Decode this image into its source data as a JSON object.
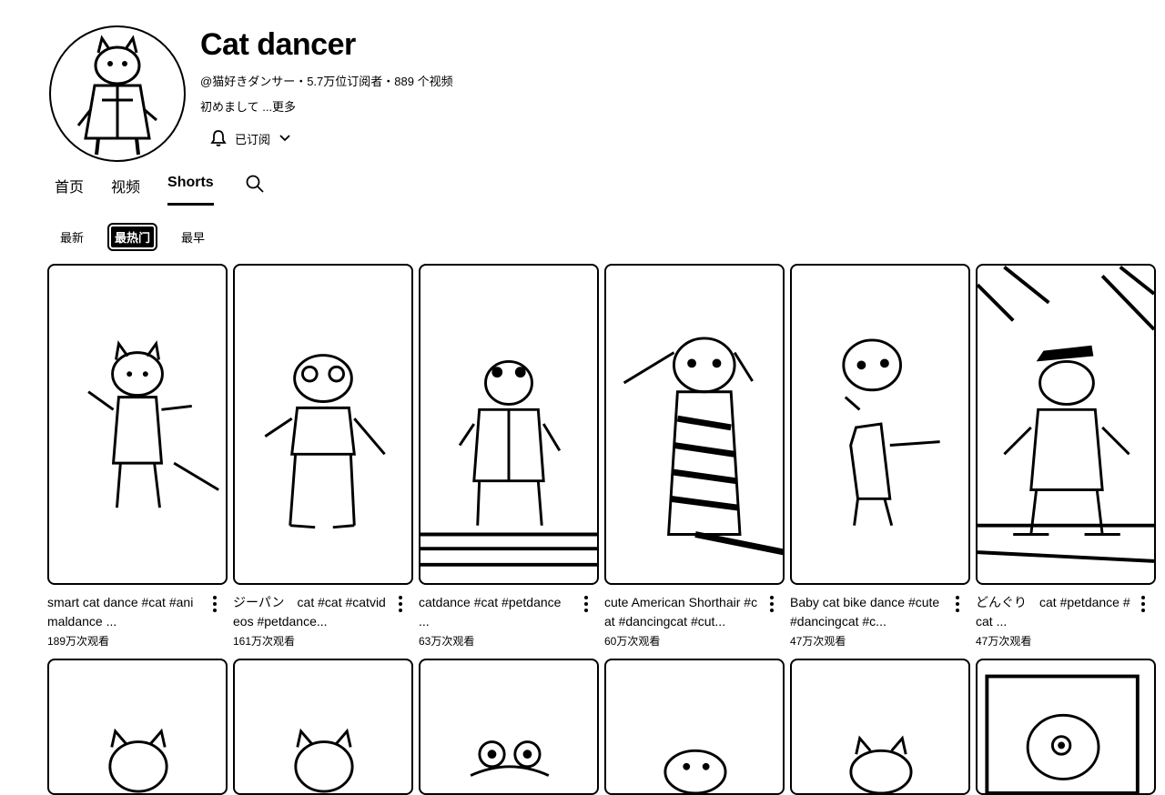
{
  "channel": {
    "name": "Cat dancer",
    "meta": "@猫好きダンサー・5.7万位订阅者・889 个视频",
    "description": "初めまして ...更多",
    "subscribe_label": "已订阅"
  },
  "tabs": [
    {
      "label": "首页",
      "active": false
    },
    {
      "label": "视频",
      "active": false
    },
    {
      "label": "Shorts",
      "active": true
    }
  ],
  "chips": [
    {
      "label": "最新",
      "active": false
    },
    {
      "label": "最热门",
      "active": true
    },
    {
      "label": "最早",
      "active": false
    }
  ],
  "videos": [
    {
      "title": "smart cat dance #cat #animaldance ...",
      "views": "189万次观看"
    },
    {
      "title": "ジーパン　cat #cat #catvideos #petdance...",
      "views": "161万次观看"
    },
    {
      "title": "catdance #cat #petdance ...",
      "views": "63万次观看"
    },
    {
      "title": "cute American Shorthair #cat #dancingcat #cut...",
      "views": "60万次观看"
    },
    {
      "title": "Baby cat bike dance #cute #dancingcat #c...",
      "views": "47万次观看"
    },
    {
      "title": "どんぐり　cat #petdance #cat ...",
      "views": "47万次观看"
    }
  ]
}
